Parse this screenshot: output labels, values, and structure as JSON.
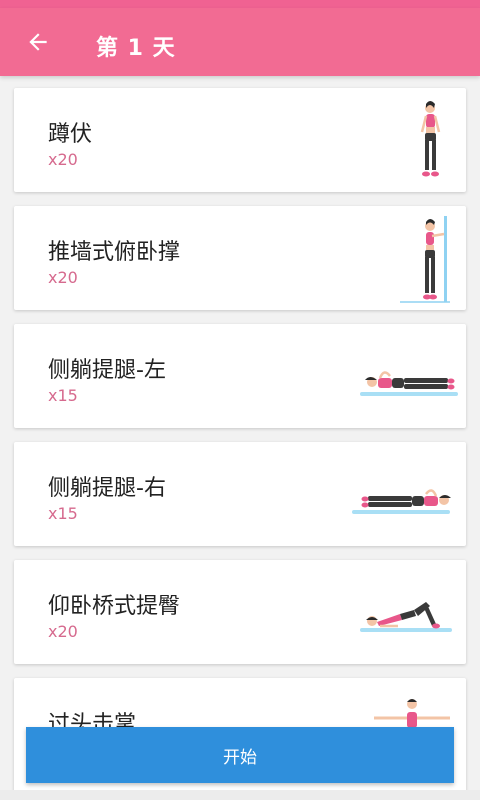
{
  "appbar": {
    "title": "第 1 天",
    "back_icon": "arrow-left-icon",
    "color": "#f26b93"
  },
  "exercises": [
    {
      "name": "蹲伏",
      "reps": "x20",
      "illustration": "standing-woman-illustration"
    },
    {
      "name": "推墙式俯卧撑",
      "reps": "x20",
      "illustration": "wall-pushup-illustration"
    },
    {
      "name": "侧躺提腿-左",
      "reps": "x15",
      "illustration": "side-lying-leg-lift-left-illustration"
    },
    {
      "name": "侧躺提腿-右",
      "reps": "x15",
      "illustration": "side-lying-leg-lift-right-illustration"
    },
    {
      "name": "仰卧桥式提臀",
      "reps": "x20",
      "illustration": "glute-bridge-illustration"
    },
    {
      "name": "过头击掌",
      "reps": "",
      "illustration": "overhead-clap-illustration"
    }
  ],
  "start_button": {
    "label": "开始",
    "color": "#2f8fdc"
  }
}
